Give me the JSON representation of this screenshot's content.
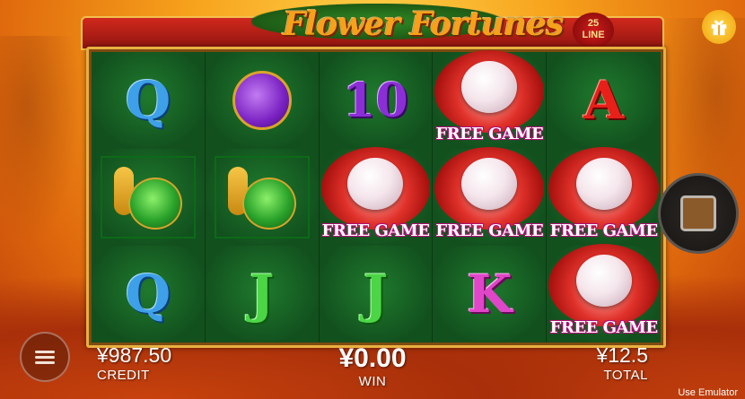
{
  "title": "Flower Fortunes",
  "line_badge": {
    "num": "25",
    "word": "LINE"
  },
  "reels": [
    [
      "q",
      "beetle",
      "10",
      "free",
      "a"
    ],
    [
      "snail",
      "snail",
      "free",
      "free",
      "free"
    ],
    [
      "q",
      "j",
      "j",
      "k",
      "free"
    ]
  ],
  "symbol_text": {
    "q": "Q",
    "j": "J",
    "k": "K",
    "a": "A",
    "10": "10",
    "free": "FREE GAME"
  },
  "credit": {
    "value": "¥987.50",
    "label": "CREDIT"
  },
  "win": {
    "value": "¥0.00",
    "label": "WIN"
  },
  "total": {
    "value": "¥12.5",
    "label": "TOTAL"
  },
  "footer": {
    "emulator": "Use Emulator"
  },
  "icons": {
    "gift": "gift-icon",
    "menu": "menu-icon",
    "spin": "stop-icon"
  }
}
